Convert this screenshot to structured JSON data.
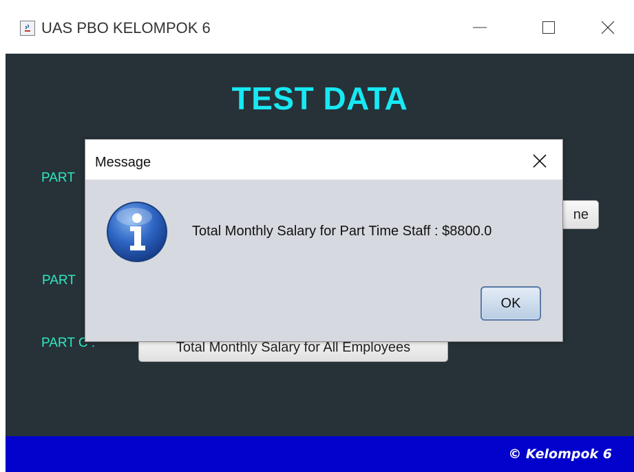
{
  "window": {
    "title": "UAS PBO KELOMPOK 6"
  },
  "main": {
    "heading": "TEST DATA",
    "part_a_label": "PART",
    "part_a_button": "ne",
    "part_b_label": "PART",
    "part_c_label": "PART C :",
    "part_c_button": "Total Monthly Salary for All Employees"
  },
  "footer": {
    "copyright": "© Kelompok 6"
  },
  "dialog": {
    "title": "Message",
    "icon": "information-icon",
    "message": "Total Monthly Salary for Part Time Staff : $8800.0",
    "ok_label": "OK"
  },
  "colors": {
    "content_bg": "#263238",
    "heading": "#18e8f4",
    "part_label": "#2ee8c2",
    "footer_bg": "#0202cc",
    "dialog_bg": "#d6d9df"
  }
}
